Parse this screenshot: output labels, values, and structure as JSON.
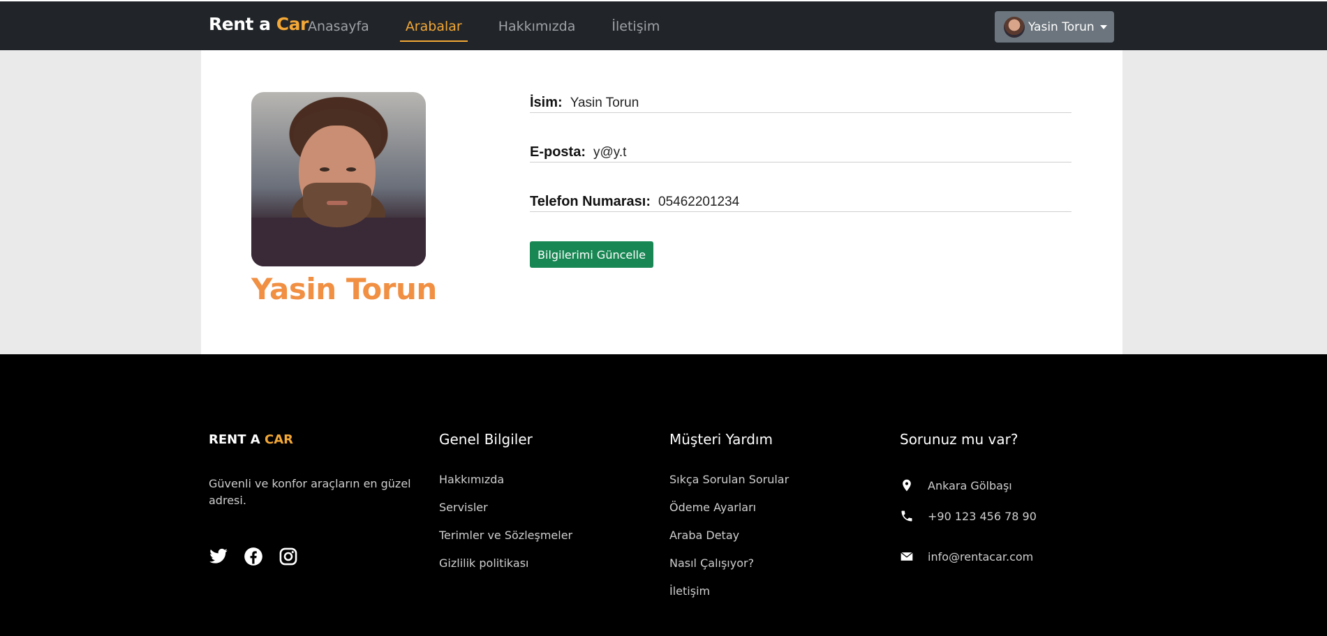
{
  "navbar": {
    "brand_main": "Rent a",
    "brand_accent": "Car",
    "links": [
      "Anasayfa",
      "Arabalar",
      "Hakkımızda",
      "İletişim"
    ],
    "active_link": "Arabalar",
    "user_name": "Yasin Torun"
  },
  "profile": {
    "name": "Yasin Torun",
    "fields": [
      {
        "label": "İsim:",
        "value": "Yasin Torun"
      },
      {
        "label": "E-posta:",
        "value": "y@y.t"
      },
      {
        "label": "Telefon Numarası:",
        "value": "05462201234"
      }
    ],
    "update_button": "Bilgilerimi Güncelle"
  },
  "footer": {
    "brand_main": "RENT A",
    "brand_accent": "CAR",
    "description": "Güvenli ve konfor araçların en güzel adresi.",
    "social": [
      "twitter-icon",
      "facebook-icon",
      "instagram-icon"
    ],
    "columns": [
      {
        "title": "Genel Bilgiler",
        "items": [
          "Hakkımızda",
          "Servisler",
          "Terimler ve Sözleşmeler",
          "Gizlilik politikası"
        ]
      },
      {
        "title": "Müşteri Yardım",
        "items": [
          "Sıkça Sorulan Sorular",
          "Ödeme Ayarları",
          "Araba Detay",
          "Nasıl Çalışıyor?",
          "İletişim"
        ]
      }
    ],
    "contact": {
      "title": "Sorunuz mu var?",
      "address": "Ankara Gölbaşı",
      "phone": "+90 123 456 78 90",
      "email": "info@rentacar.com"
    }
  },
  "colors": {
    "accent": "#f4a836",
    "profile_name": "#f18f42",
    "button": "#198754",
    "navbar": "#212529",
    "footer": "#000000"
  }
}
